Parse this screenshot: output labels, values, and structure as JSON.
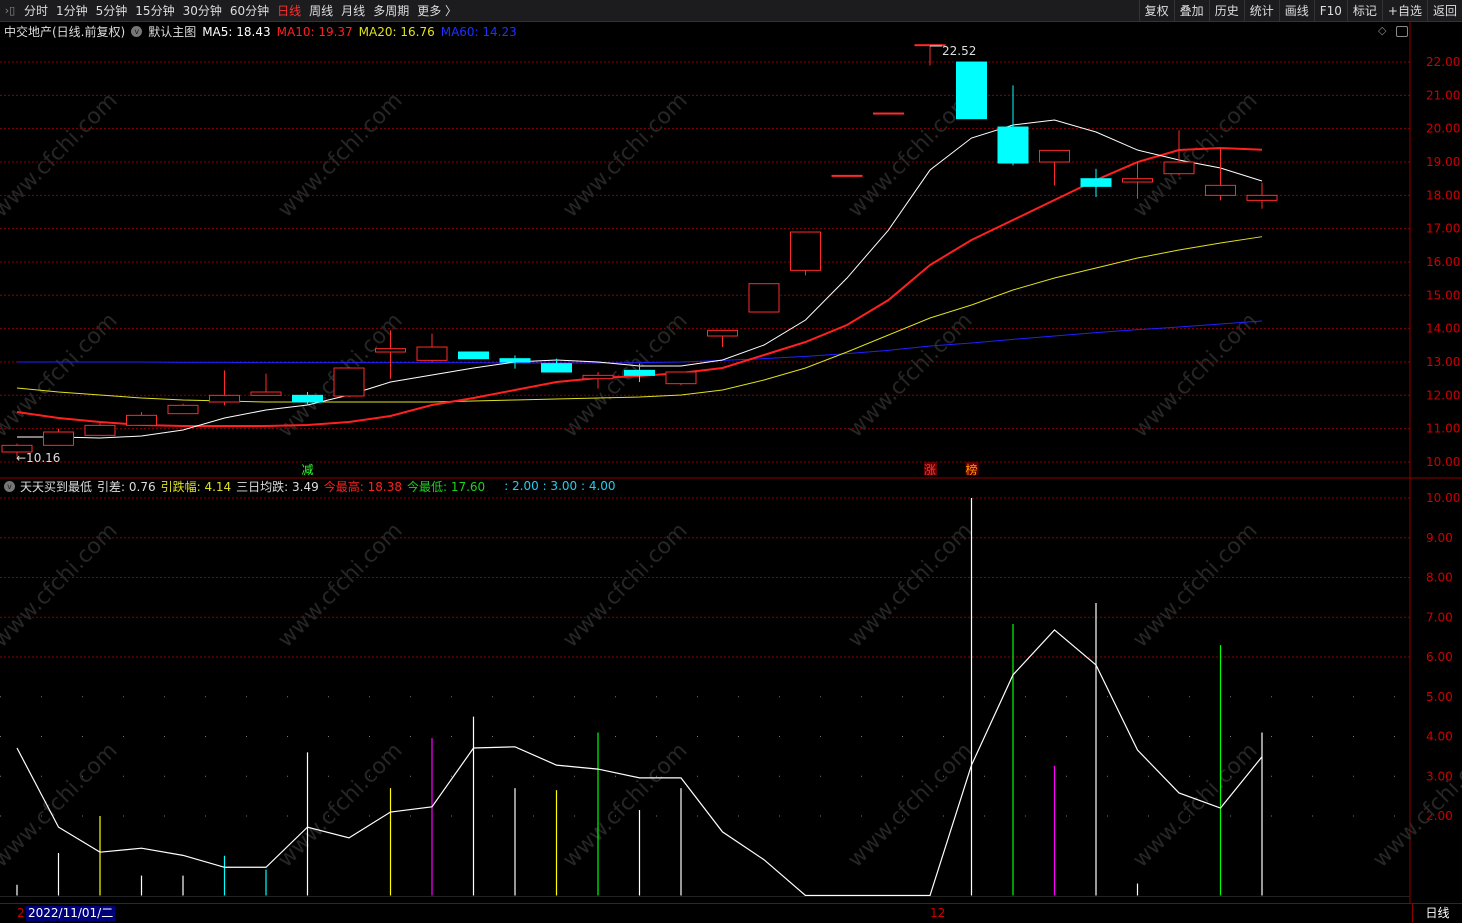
{
  "toolbar": {
    "periods": [
      "分时",
      "1分钟",
      "5分钟",
      "15分钟",
      "30分钟",
      "60分钟",
      "日线",
      "周线",
      "月线",
      "多周期",
      "更多 〉"
    ],
    "active": "日线",
    "right": [
      "复权",
      "叠加",
      "历史",
      "统计",
      "画线",
      "F10",
      "标记",
      "+自选",
      "返回"
    ]
  },
  "header": {
    "name": "中交地产(日线.前复权)",
    "template": "默认主图",
    "ma5": "MA5: 18.43",
    "ma10": "MA10: 19.37",
    "ma20": "MA20: 16.76",
    "ma60": "MA60: 14.23"
  },
  "indicator": {
    "name": "天天买到最低",
    "yc": "引差: 0.76",
    "ydf": "引跌幅: 4.14",
    "srjd": "三日均跌: 3.49",
    "high": "今最高: 18.38",
    "low": "今最低: 17.60",
    "levels": ": 2.00 : 3.00 : 4.00"
  },
  "bottom": {
    "left_mark": "2",
    "date": "2022/11/01/二",
    "month_mark": "12",
    "period": "日线"
  },
  "watermark": "www.cfchi.com",
  "colors": {
    "up": "#ff2a2a",
    "down": "#00ffff",
    "ma5": "#ffffff",
    "ma10": "#ff2020",
    "ma20": "#e0e020",
    "ma60": "#2020ff",
    "grid": "#8b0000"
  },
  "chart_data": [
    {
      "type": "candlestick",
      "title": "中交地产 日线",
      "ylim": [
        10,
        22
      ],
      "yticks": [
        "22.00",
        "21.00",
        "20.00",
        "19.00",
        "18.00",
        "17.00",
        "16.00",
        "15.00",
        "14.00",
        "13.00",
        "12.00",
        "11.00",
        "10.00"
      ],
      "max_label": "22.52",
      "min_label": "←10.16",
      "candles": [
        [
          10.3,
          10.5,
          10.55,
          10.16
        ],
        [
          10.5,
          10.9,
          11.0,
          10.5
        ],
        [
          10.8,
          11.1,
          11.2,
          10.8
        ],
        [
          11.1,
          11.4,
          11.5,
          11.1
        ],
        [
          11.45,
          11.7,
          11.75,
          11.45
        ],
        [
          11.8,
          12.0,
          12.75,
          11.7
        ],
        [
          12.0,
          12.1,
          12.65,
          12.0
        ],
        [
          12.0,
          11.8,
          12.1,
          11.7
        ],
        [
          11.98,
          12.82,
          12.85,
          11.95
        ],
        [
          13.3,
          13.4,
          13.95,
          12.5
        ],
        [
          13.05,
          13.45,
          13.85,
          13.0
        ],
        [
          13.3,
          13.1,
          13.3,
          13.1
        ],
        [
          13.1,
          13.0,
          13.2,
          12.8
        ],
        [
          12.95,
          12.7,
          13.1,
          12.7
        ],
        [
          12.5,
          12.6,
          12.7,
          12.2
        ],
        [
          12.75,
          12.6,
          12.95,
          12.4
        ],
        [
          12.35,
          12.7,
          12.7,
          12.3
        ],
        [
          13.78,
          13.95,
          13.95,
          13.45
        ],
        [
          14.5,
          15.35,
          15.35,
          14.5
        ],
        [
          15.75,
          16.9,
          16.9,
          15.6
        ],
        [
          18.6,
          18.6,
          18.6,
          18.6
        ],
        [
          20.47,
          20.47,
          20.47,
          20.47
        ],
        [
          22.52,
          22.52,
          22.52,
          21.9
        ],
        [
          22.0,
          20.3,
          22.0,
          20.3
        ],
        [
          20.05,
          18.97,
          21.3,
          18.9
        ],
        [
          19.0,
          19.35,
          19.35,
          18.3
        ],
        [
          18.5,
          18.27,
          18.8,
          17.95
        ],
        [
          18.4,
          18.5,
          19.0,
          17.9
        ],
        [
          18.65,
          19.0,
          19.95,
          18.6
        ],
        [
          18.0,
          18.3,
          19.4,
          17.85
        ],
        [
          17.85,
          18.0,
          18.38,
          17.6
        ]
      ],
      "ma5": [
        10.75,
        10.75,
        10.72,
        10.78,
        10.96,
        11.32,
        11.56,
        11.71,
        12.01,
        12.4,
        12.61,
        12.82,
        13.0,
        13.06,
        13.0,
        12.88,
        12.88,
        13.06,
        13.51,
        14.26,
        15.52,
        16.96,
        18.76,
        19.72,
        20.11,
        20.26,
        19.9,
        19.36,
        19.06,
        18.82,
        18.43
      ],
      "ma10": [
        11.5,
        11.32,
        11.2,
        11.11,
        11.08,
        11.08,
        11.08,
        11.11,
        11.2,
        11.38,
        11.71,
        11.92,
        12.16,
        12.4,
        12.52,
        12.58,
        12.67,
        12.82,
        13.21,
        13.6,
        14.11,
        14.86,
        15.91,
        16.66,
        17.26,
        17.86,
        18.46,
        19.0,
        19.36,
        19.42,
        19.37
      ],
      "ma20": [
        12.22,
        12.1,
        12.01,
        11.92,
        11.86,
        11.83,
        11.8,
        11.8,
        11.8,
        11.8,
        11.8,
        11.83,
        11.86,
        11.89,
        11.92,
        11.95,
        12.01,
        12.16,
        12.46,
        12.82,
        13.3,
        13.81,
        14.32,
        14.71,
        15.16,
        15.52,
        15.82,
        16.12,
        16.36,
        16.57,
        16.76
      ],
      "ma60": [
        13.0,
        13.0,
        13.0,
        13.0,
        12.99,
        12.99,
        12.98,
        12.98,
        12.98,
        12.98,
        12.98,
        12.98,
        12.97,
        12.97,
        12.97,
        12.98,
        13.0,
        13.05,
        13.1,
        13.17,
        13.25,
        13.35,
        13.48,
        13.57,
        13.68,
        13.78,
        13.88,
        13.97,
        14.05,
        14.14,
        14.23
      ],
      "signals": [
        {
          "index": 7,
          "text": "减",
          "color": "#30ff30"
        },
        {
          "index": 22,
          "text": "涨",
          "color": "#ff3030"
        },
        {
          "index": 23,
          "text": "榜",
          "color": "#ff9900"
        }
      ]
    },
    {
      "type": "line+bar",
      "title": "天天买到最低",
      "ylim": [
        0,
        10
      ],
      "yticks": [
        "10.00",
        "9.00",
        "8.00",
        "7.00",
        "6.00",
        "5.00",
        "4.00",
        "3.00",
        "2.00"
      ],
      "line": [
        3.71,
        1.72,
        1.09,
        1.19,
        1.01,
        0.71,
        0.71,
        1.72,
        1.45,
        2.1,
        2.23,
        3.71,
        3.74,
        3.28,
        3.18,
        2.96,
        2.96,
        1.6,
        0.9,
        0,
        0,
        0,
        0,
        3.28,
        5.55,
        6.68,
        5.8,
        3.66,
        2.58,
        2.2,
        3.49
      ],
      "bars": [
        [
          0.27,
          "#ffffff"
        ],
        [
          1.07,
          "#ffffff"
        ],
        [
          2.0,
          "#ffff00"
        ],
        [
          0.5,
          "#ffffff"
        ],
        [
          0.5,
          "#ffffff"
        ],
        [
          1.0,
          "#00ffff"
        ],
        [
          0.65,
          "#00ffff"
        ],
        [
          3.6,
          "#ffffff"
        ],
        [
          0,
          "#ffffff"
        ],
        [
          2.7,
          "#ffff00"
        ],
        [
          3.96,
          "#ff00ff"
        ],
        [
          4.5,
          "#ffffff"
        ],
        [
          2.7,
          "#ffffff"
        ],
        [
          2.65,
          "#ffff00"
        ],
        [
          4.1,
          "#00ff00"
        ],
        [
          2.15,
          "#ffffff"
        ],
        [
          2.7,
          "#ffffff"
        ],
        [
          0,
          "#fff"
        ],
        [
          0,
          "#fff"
        ],
        [
          0,
          "#fff"
        ],
        [
          0,
          "#fff"
        ],
        [
          0,
          "#fff"
        ],
        [
          0,
          "#fff"
        ],
        [
          10,
          "#ffffff"
        ],
        [
          6.83,
          "#00ff00"
        ],
        [
          3.26,
          "#ff00ff"
        ],
        [
          7.36,
          "#ffffff"
        ],
        [
          0.3,
          "#ffffff"
        ],
        [
          0,
          "#fff"
        ],
        [
          6.3,
          "#00ff00"
        ],
        [
          4.1,
          "#ffffff"
        ]
      ]
    }
  ]
}
